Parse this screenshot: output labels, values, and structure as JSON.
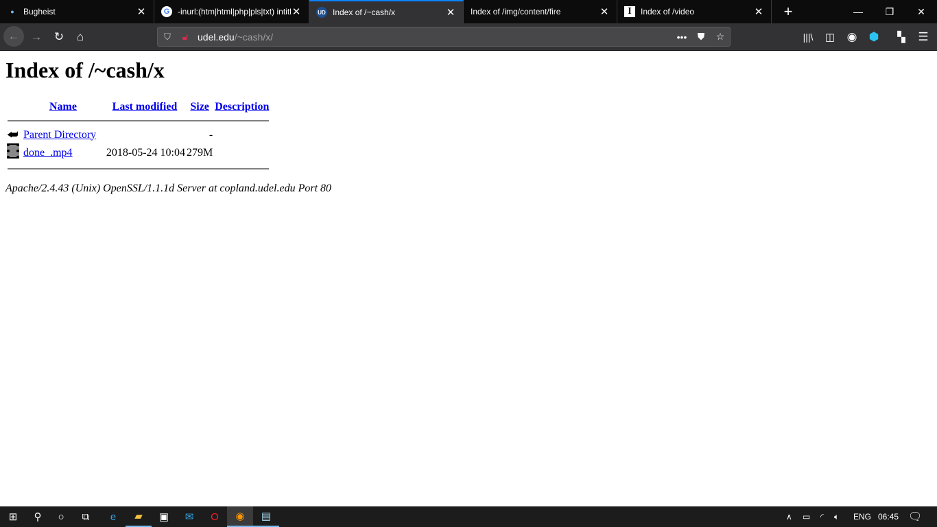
{
  "browser": {
    "tabs": [
      {
        "title": "Bugheist",
        "icon": "dot-icon",
        "active": false
      },
      {
        "title": "-inurl:(htm|html|php|pls|txt) intitle:index.of",
        "icon": "google-icon",
        "active": false
      },
      {
        "title": "Index of /~cash/x",
        "icon": "udel-icon",
        "active": true
      },
      {
        "title": "Index of /img/content/fire",
        "icon": "none",
        "active": false
      },
      {
        "title": "Index of /video",
        "icon": "instapaper-icon",
        "active": false
      }
    ],
    "url": {
      "domain": "udel.edu",
      "path": "/~cash/x/"
    }
  },
  "page": {
    "title": "Index of /~cash/x",
    "columns": [
      "Name",
      "Last modified",
      "Size",
      "Description"
    ],
    "rows": [
      {
        "name": "Parent Directory",
        "modified": "",
        "size": "-",
        "description": "",
        "icon": "back-arrow-icon"
      },
      {
        "name": "done_.mp4",
        "modified": "2018-05-24 10:04",
        "size": "279M",
        "description": "",
        "icon": "film-icon"
      }
    ],
    "footer": "Apache/2.4.43 (Unix) OpenSSL/1.1.1d Server at copland.udel.edu Port 80"
  },
  "taskbar": {
    "language": "ENG",
    "time": "06:45"
  },
  "colors": {
    "accent": "#0a84ff",
    "link": "#0000ee"
  }
}
